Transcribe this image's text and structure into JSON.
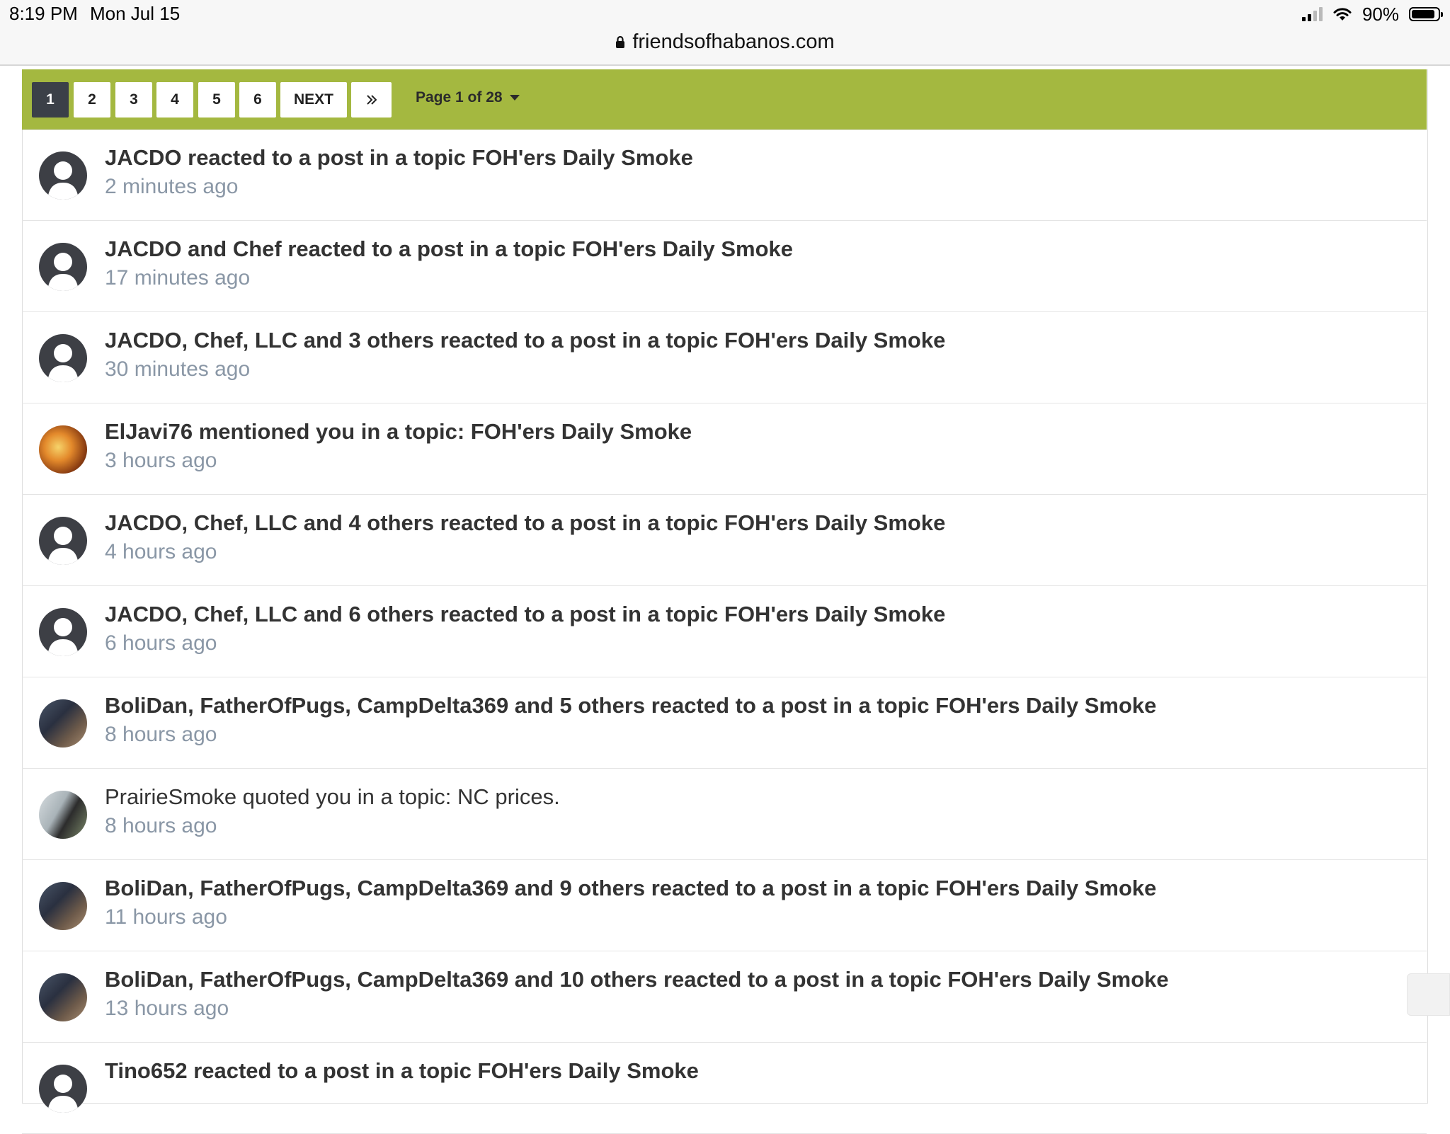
{
  "status_bar": {
    "time": "8:19 PM",
    "date": "Mon Jul 15",
    "battery": "90%",
    "battery_level": 0.9
  },
  "browser": {
    "url": "friendsofhabanos.com"
  },
  "pagination": {
    "pages": [
      "1",
      "2",
      "3",
      "4",
      "5",
      "6"
    ],
    "active_page": "1",
    "next_label": "NEXT",
    "last_label": "»",
    "page_info": "Page 1 of 28"
  },
  "notifications": [
    {
      "text": "JACDO reacted to a post in a topic FOH'ers Daily Smoke",
      "time": "2 minutes ago"
    },
    {
      "text": "JACDO and Chef reacted to a post in a topic FOH'ers Daily Smoke",
      "time": "17 minutes ago"
    },
    {
      "text": "JACDO, Chef, LLC and 3 others reacted to a post in a topic FOH'ers Daily Smoke",
      "time": "30 minutes ago"
    },
    {
      "text": "ElJavi76 mentioned you in a topic: FOH'ers Daily Smoke",
      "time": "3 hours ago"
    },
    {
      "text": "JACDO, Chef, LLC and 4 others reacted to a post in a topic FOH'ers Daily Smoke",
      "time": "4 hours ago"
    },
    {
      "text": "JACDO, Chef, LLC and 6 others reacted to a post in a topic FOH'ers Daily Smoke",
      "time": "6 hours ago"
    },
    {
      "text": "BoliDan, FatherOfPugs, CampDelta369 and 5 others reacted to a post in a topic FOH'ers Daily Smoke",
      "time": "8 hours ago"
    },
    {
      "text": "PrairieSmoke quoted you in a topic: NC prices.",
      "time": "8 hours ago"
    },
    {
      "text": "BoliDan, FatherOfPugs, CampDelta369 and 9 others reacted to a post in a topic FOH'ers Daily Smoke",
      "time": "11 hours ago"
    },
    {
      "text": "BoliDan, FatherOfPugs, CampDelta369 and 10 others reacted to a post in a topic FOH'ers Daily Smoke",
      "time": "13 hours ago"
    },
    {
      "text": "Tino652 reacted to a post in a topic FOH'ers Daily Smoke",
      "time": ""
    }
  ]
}
